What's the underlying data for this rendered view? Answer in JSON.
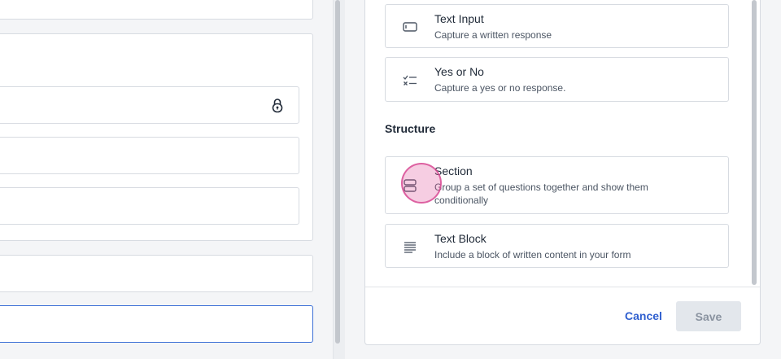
{
  "panel": {
    "options": [
      {
        "title": "Text Input",
        "description": "Capture a written response",
        "icon": "text-input-icon"
      },
      {
        "title": "Yes or No",
        "description": "Capture a yes or no response.",
        "icon": "checklist-icon"
      }
    ],
    "structure_heading": "Structure",
    "structure_options": [
      {
        "title": "Section",
        "description": "Group a set of questions together and show them conditionally",
        "icon": "section-icon"
      },
      {
        "title": "Text Block",
        "description": "Include a block of written content in your form",
        "icon": "text-block-icon"
      }
    ],
    "cancel_label": "Cancel",
    "save_label": "Save"
  },
  "colors": {
    "accent": "#2f5fcf",
    "focus_border": "#3b6fd6",
    "save_disabled_bg": "#e3e7ec",
    "click_indicator": "#e15aa0"
  }
}
